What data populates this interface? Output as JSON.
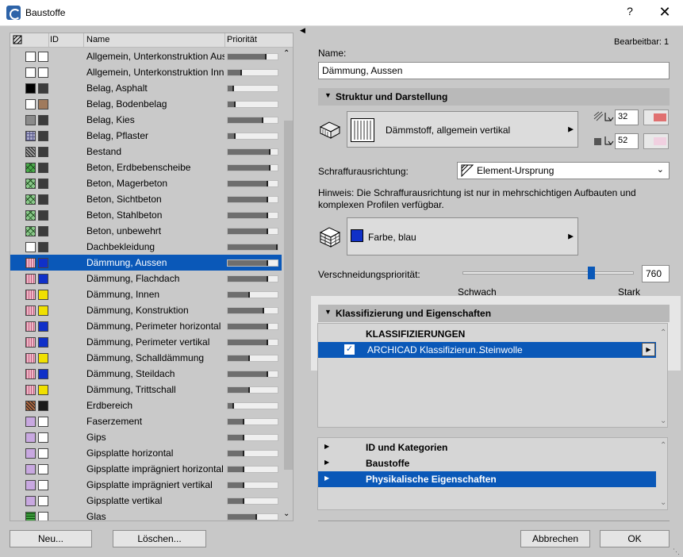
{
  "window": {
    "title": "Baustoffe",
    "help_label": "?",
    "close_label": "✕",
    "app_icon": "archicad-icon"
  },
  "list": {
    "headers": {
      "id": "ID",
      "name": "Name",
      "priority": "Priorität"
    },
    "items": [
      {
        "name": "Allgemein, Unterkonstruktion Auss",
        "c1": "#ffffff",
        "c2": "#ffffff",
        "pat": "",
        "prio": 0.75,
        "tick": 0.75
      },
      {
        "name": "Allgemein, Unterkonstruktion Inn",
        "c1": "#ffffff",
        "c2": "#ffffff",
        "pat": "",
        "prio": 0.25,
        "tick": 0.25
      },
      {
        "name": "Belag, Asphalt",
        "c1": "#000000",
        "c2": "#3c3c3c",
        "pat": "",
        "prio": 0.1,
        "tick": 0.1
      },
      {
        "name": "Belag, Bodenbelag",
        "c1": "#ffffff",
        "c2": "#a07a5c",
        "pat": "",
        "prio": 0.12,
        "tick": 0.12
      },
      {
        "name": "Belag, Kies",
        "c1": "#8a8a8a",
        "c2": "#3c3c3c",
        "pat": "",
        "prio": 0.68,
        "tick": 0.68
      },
      {
        "name": "Belag, Pflaster",
        "c1": "#a8a8c8",
        "c2": "#3c3c3c",
        "pat": "grid",
        "prio": 0.12,
        "tick": 0.12
      },
      {
        "name": "Bestand",
        "c1": "#9c9c9c",
        "c2": "#3c3c3c",
        "pat": "hatch",
        "prio": 0.82,
        "tick": 0.82
      },
      {
        "name": "Beton, Erdbebenscheibe",
        "c1": "#4aa84a",
        "c2": "#3c3c3c",
        "pat": "cross",
        "prio": 0.82,
        "tick": 0.82
      },
      {
        "name": "Beton, Magerbeton",
        "c1": "#8ac88a",
        "c2": "#3c3c3c",
        "pat": "cross",
        "prio": 0.78,
        "tick": 0.78
      },
      {
        "name": "Beton, Sichtbeton",
        "c1": "#8ac88a",
        "c2": "#3c3c3c",
        "pat": "cross",
        "prio": 0.78,
        "tick": 0.78
      },
      {
        "name": "Beton, Stahlbeton",
        "c1": "#8ac88a",
        "c2": "#3c3c3c",
        "pat": "cross",
        "prio": 0.78,
        "tick": 0.78
      },
      {
        "name": "Beton, unbewehrt",
        "c1": "#8ac88a",
        "c2": "#3c3c3c",
        "pat": "cross",
        "prio": 0.78,
        "tick": 0.78
      },
      {
        "name": "Dachbekleidung",
        "c1": "#ffffff",
        "c2": "#3c3c3c",
        "pat": "",
        "prio": 0.97,
        "tick": 0.97
      },
      {
        "name": "Dämmung, Aussen",
        "c1": "#f0b8c8",
        "c2": "#1030c8",
        "pat": "lines",
        "prio": 0.77,
        "tick": 0.77,
        "selected": true
      },
      {
        "name": "Dämmung, Flachdach",
        "c1": "#f0b8c8",
        "c2": "#1030c8",
        "pat": "lines",
        "prio": 0.77,
        "tick": 0.77
      },
      {
        "name": "Dämmung, Innen",
        "c1": "#f0b8c8",
        "c2": "#f0e000",
        "pat": "lines",
        "prio": 0.42,
        "tick": 0.42
      },
      {
        "name": "Dämmung, Konstruktion",
        "c1": "#f0b8c8",
        "c2": "#f0e000",
        "pat": "lines",
        "prio": 0.7,
        "tick": 0.7
      },
      {
        "name": "Dämmung, Perimeter horizontal",
        "c1": "#f0b8c8",
        "c2": "#1030c8",
        "pat": "lines",
        "prio": 0.77,
        "tick": 0.77
      },
      {
        "name": "Dämmung, Perimeter vertikal",
        "c1": "#f0b8c8",
        "c2": "#1030c8",
        "pat": "lines",
        "prio": 0.77,
        "tick": 0.77
      },
      {
        "name": "Dämmung, Schalldämmung",
        "c1": "#f0b8c8",
        "c2": "#f0e000",
        "pat": "lines",
        "prio": 0.42,
        "tick": 0.42
      },
      {
        "name": "Dämmung, Steildach",
        "c1": "#f0b8c8",
        "c2": "#1030c8",
        "pat": "lines",
        "prio": 0.77,
        "tick": 0.77
      },
      {
        "name": "Dämmung, Trittschall",
        "c1": "#f0b8c8",
        "c2": "#f0e000",
        "pat": "lines",
        "prio": 0.42,
        "tick": 0.42
      },
      {
        "name": "Erdbereich",
        "c1": "#b06840",
        "c2": "#1a1a1a",
        "pat": "hatch",
        "prio": 0.1,
        "tick": 0.1
      },
      {
        "name": "Faserzement",
        "c1": "#c8a8e0",
        "c2": "#ffffff",
        "pat": "",
        "prio": 0.3,
        "tick": 0.3
      },
      {
        "name": "Gips",
        "c1": "#c8a8e0",
        "c2": "#ffffff",
        "pat": "",
        "prio": 0.3,
        "tick": 0.3
      },
      {
        "name": "Gipsplatte horizontal",
        "c1": "#c8a8e0",
        "c2": "#ffffff",
        "pat": "",
        "prio": 0.3,
        "tick": 0.3
      },
      {
        "name": "Gipsplatte imprägniert horizontal",
        "c1": "#c8a8e0",
        "c2": "#ffffff",
        "pat": "",
        "prio": 0.3,
        "tick": 0.3
      },
      {
        "name": "Gipsplatte imprägniert vertikal",
        "c1": "#c8a8e0",
        "c2": "#ffffff",
        "pat": "",
        "prio": 0.3,
        "tick": 0.3
      },
      {
        "name": "Gipsplatte vertikal",
        "c1": "#c8a8e0",
        "c2": "#ffffff",
        "pat": "",
        "prio": 0.3,
        "tick": 0.3
      },
      {
        "name": "Glas",
        "c1": "#40a040",
        "c2": "#ffffff",
        "pat": "stripes",
        "prio": 0.55,
        "tick": 0.55
      }
    ]
  },
  "buttons": {
    "new": "Neu...",
    "delete": "Löschen...",
    "cancel": "Abbrechen",
    "ok": "OK"
  },
  "editable": "Bearbeitbar: 1",
  "name_label": "Name:",
  "name_value": "Dämmung, Aussen",
  "section_structure": "Struktur und Darstellung",
  "fill_name": "Dämmstoff, allgemein vertikal",
  "pen_fg": "32",
  "pen_bg": "52",
  "pen_fg_color": "#e07070",
  "pen_bg_color": "#f0d0e0",
  "orientation_label": "Schraffurausrichtung:",
  "orientation_value": "Element-Ursprung",
  "hint": "Hinweis: Die Schraffurausrichtung ist nur in mehrschichtigen Aufbauten und komplexen Profilen verfügbar.",
  "surface_name": "Farbe, blau",
  "surface_color": "#1030c8",
  "priority_label": "Verschneidungspriorität:",
  "priority_value": "760",
  "priority_level": 0.75,
  "priority_min": "Schwach",
  "priority_max": "Stark",
  "section_class": "Klassifizierung und Eigenschaften",
  "class_header": "KLASSIFIZIERUNGEN",
  "class_system": "ARCHICAD Klassifizierun...",
  "class_value": "Steinwolle",
  "prop_rows": [
    "ID und Kategorien",
    "Baustoffe",
    "Physikalische Eigenschaften"
  ]
}
